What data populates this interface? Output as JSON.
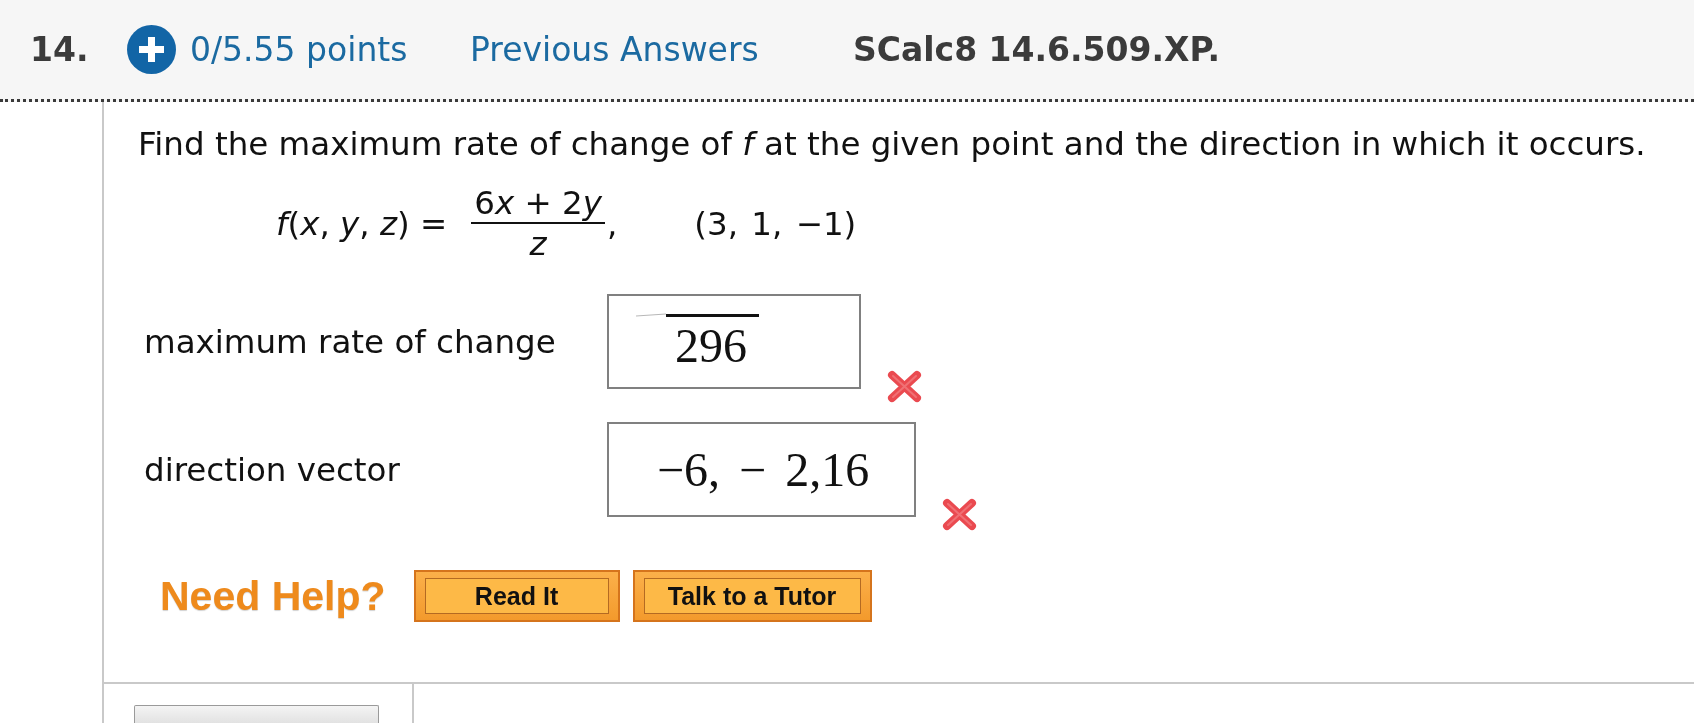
{
  "question": {
    "number": "14.",
    "points": "0/5.55 points",
    "previous_answers": "Previous Answers",
    "source": "SCalc8 14.6.509.XP."
  },
  "prompt": "Find the maximum rate of change of *f* at the given point and the direction in which it occurs.",
  "formula": {
    "lhs": "*f*(*x*, *y*, *z*) =",
    "numerator": [
      {
        "text": "6",
        "italic": false
      },
      {
        "text": "x",
        "italic": true
      },
      {
        "text": " + 2",
        "italic": false
      },
      {
        "text": "y",
        "italic": true
      }
    ],
    "denominator": "z",
    "separator": ",",
    "point": "(3, 1, −1)"
  },
  "answers": [
    {
      "label": "maximum rate of change",
      "value": "296",
      "radical": true,
      "correct": false
    },
    {
      "label": "direction vector",
      "value": "−6, − 2,16",
      "radical": false,
      "correct": false
    }
  ],
  "help": {
    "title": "Need Help?",
    "buttons": [
      "Read It",
      "Talk to a Tutor"
    ]
  }
}
